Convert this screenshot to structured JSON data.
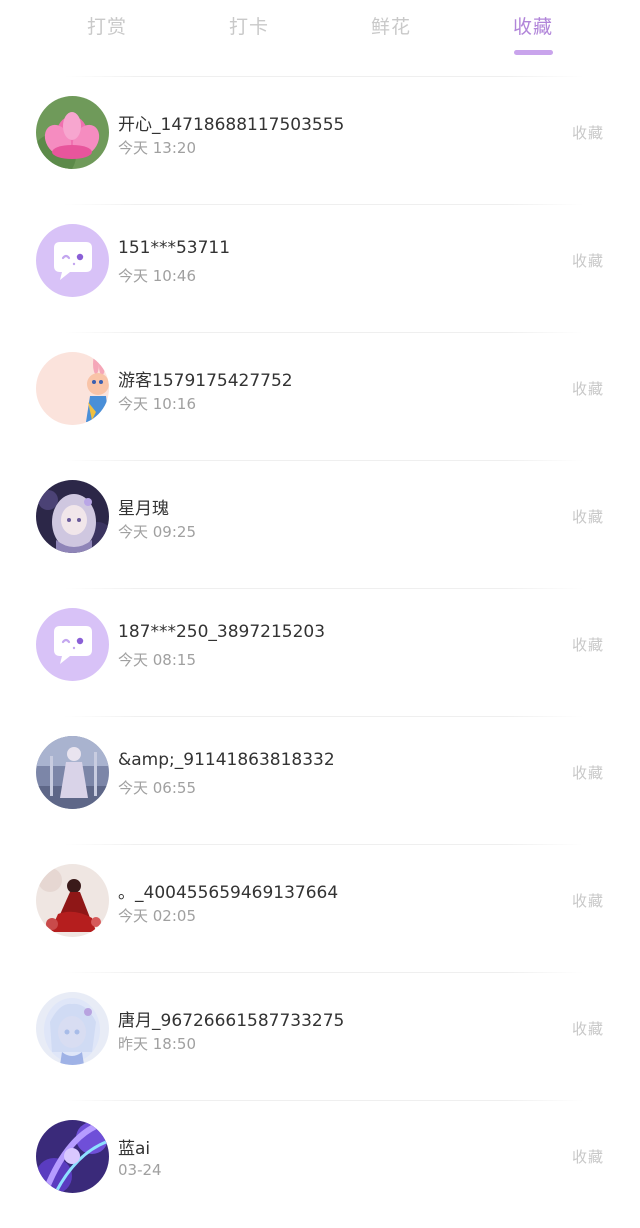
{
  "tabs": [
    {
      "label": "打赏",
      "active": false
    },
    {
      "label": "打卡",
      "active": false
    },
    {
      "label": "鲜花",
      "active": false
    },
    {
      "label": "收藏",
      "active": true
    }
  ],
  "colors": {
    "accent": "#b185d9",
    "accent_underline": "#c9a4ec",
    "inactive_tab": "#c9c9c9",
    "name_text": "#333333",
    "time_text": "#a0a0a0",
    "action_text": "#c8c8c8",
    "default_avatar_bg": "#d8c2f7"
  },
  "items": [
    {
      "name": "开心_14718688117503555",
      "time": "今天 13:20",
      "action": "收藏",
      "avatar": "lotus-avatar"
    },
    {
      "name": "151***53711",
      "time": "今天 10:46",
      "action": "收藏",
      "avatar": "default-chat-avatar"
    },
    {
      "name": "游客1579175427752",
      "time": "今天 10:16",
      "action": "收藏",
      "avatar": "cartoon-bunny-avatar"
    },
    {
      "name": "星月瑰",
      "time": "今天 09:25",
      "action": "收藏",
      "avatar": "anime-girl-avatar"
    },
    {
      "name": "187***250_3897215203",
      "time": "今天 08:15",
      "action": "收藏",
      "avatar": "default-chat-avatar"
    },
    {
      "name": "&amp;_91141863818332",
      "time": "今天 06:55",
      "action": "收藏",
      "avatar": "figure-photo-avatar"
    },
    {
      "name": "。_400455659469137664",
      "time": "今天 02:05",
      "action": "收藏",
      "avatar": "red-dress-avatar"
    },
    {
      "name": "唐月_96726661587733275",
      "time": "昨天 18:50",
      "action": "收藏",
      "avatar": "anime-white-hair-avatar"
    },
    {
      "name": "蓝ai",
      "time": "03-24",
      "action": "收藏",
      "avatar": "purple-fantasy-avatar"
    }
  ]
}
